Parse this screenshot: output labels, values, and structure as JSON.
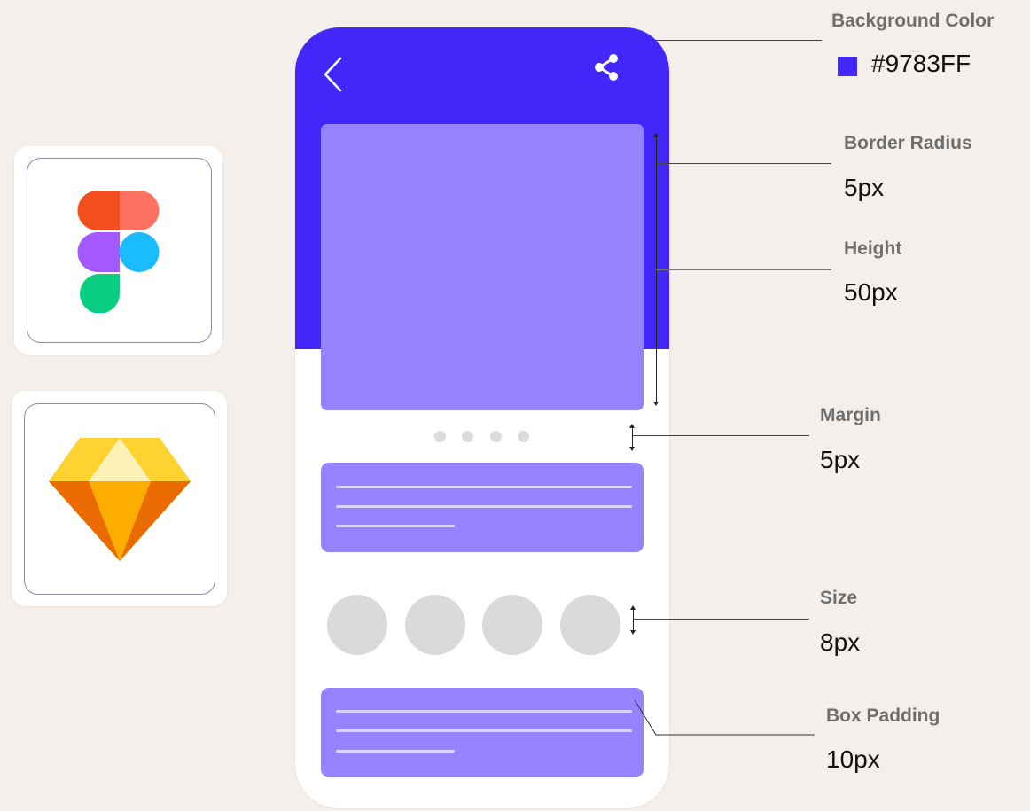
{
  "tools": [
    {
      "name": "figma-logo"
    },
    {
      "name": "sketch-logo"
    }
  ],
  "phone": {
    "header_color": "#4326F9",
    "card_color": "#9783FF",
    "icons": {
      "back": "chevron-left-icon",
      "share": "share-icon"
    }
  },
  "annotations": {
    "background_color": {
      "title": "Background Color",
      "value": "#9783FF",
      "swatch": "#4326F9"
    },
    "border_radius": {
      "title": "Border Radius",
      "value": "5px"
    },
    "height": {
      "title": "Height",
      "value": "50px"
    },
    "margin": {
      "title": "Margin",
      "value": "5px"
    },
    "size": {
      "title": "Size",
      "value": "8px"
    },
    "box_padding": {
      "title": "Box Padding",
      "value": "10px"
    }
  }
}
